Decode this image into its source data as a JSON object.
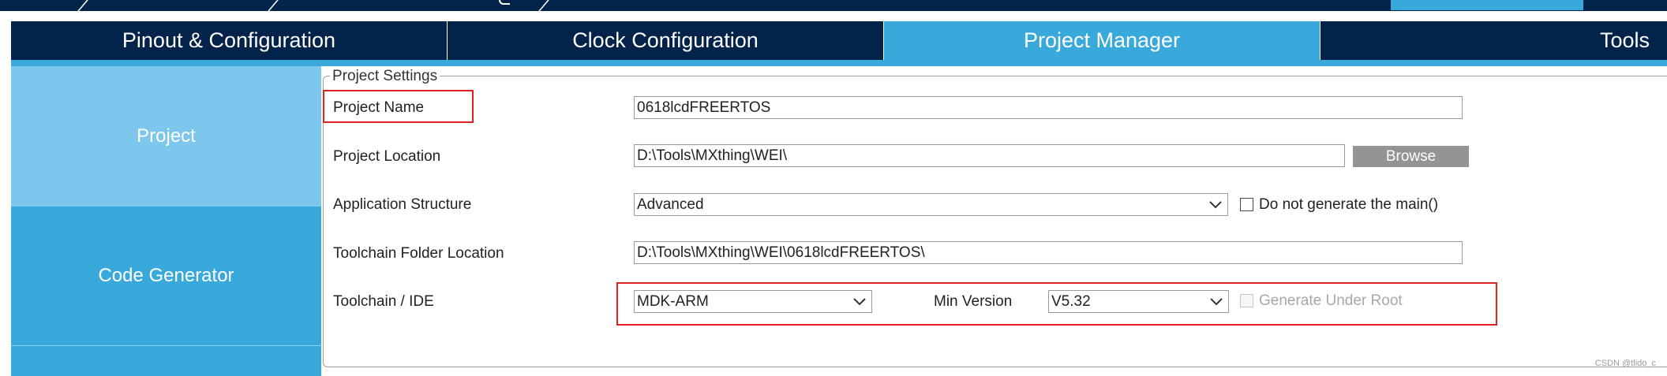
{
  "tabs": [
    {
      "label": "Pinout & Configuration",
      "active": false
    },
    {
      "label": "Clock Configuration",
      "active": false
    },
    {
      "label": "Project Manager",
      "active": true
    },
    {
      "label": "Tools",
      "active": false
    }
  ],
  "sidebar": {
    "items": [
      {
        "label": "Project",
        "active": true
      },
      {
        "label": "Code Generator",
        "active": false
      }
    ]
  },
  "project_settings": {
    "legend": "Project Settings",
    "project_name_label": "Project Name",
    "project_name_value": "0618lcdFREERTOS",
    "project_location_label": "Project Location",
    "project_location_value": "D:\\Tools\\MXthing\\WEI\\",
    "browse_label": "Browse",
    "app_structure_label": "Application Structure",
    "app_structure_value": "Advanced",
    "no_main_label": "Do not generate the main()",
    "no_main_checked": false,
    "toolchain_folder_label": "Toolchain Folder Location",
    "toolchain_folder_value": "D:\\Tools\\MXthing\\WEI\\0618lcdFREERTOS\\",
    "toolchain_ide_label": "Toolchain / IDE",
    "toolchain_ide_value": "MDK-ARM",
    "min_version_label": "Min Version",
    "min_version_value": "V5.32",
    "generate_under_root_label": "Generate Under Root",
    "generate_under_root_checked": false,
    "generate_under_root_enabled": false
  },
  "watermark": "CSDN @tlido_c",
  "colors": {
    "navy": "#03234b",
    "accent": "#39a9dc",
    "sidebar_active": "#7cc7eb",
    "highlight_red": "#e02020"
  }
}
